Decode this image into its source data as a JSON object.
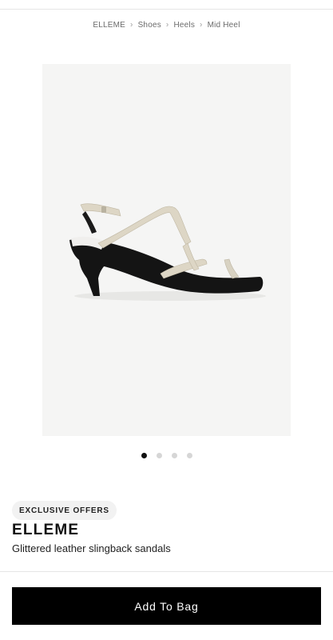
{
  "breadcrumb": {
    "items": [
      "ELLEME",
      "Shoes",
      "Heels",
      "Mid Heel"
    ],
    "separator": "›"
  },
  "gallery": {
    "image_alt": "Glittered leather slingback sandal",
    "slide_count": 4,
    "active_index": 0
  },
  "product": {
    "badge": "EXCLUSIVE OFFERS",
    "brand": "ELLEME",
    "name": "Glittered leather slingback sandals"
  },
  "actions": {
    "add_to_bag_label": "Add To Bag"
  },
  "colors": {
    "button_bg": "#000000",
    "button_text": "#ffffff",
    "active_dot": "#111111",
    "inactive_dot": "#d6d6d6",
    "image_bg": "#f5f5f4"
  }
}
